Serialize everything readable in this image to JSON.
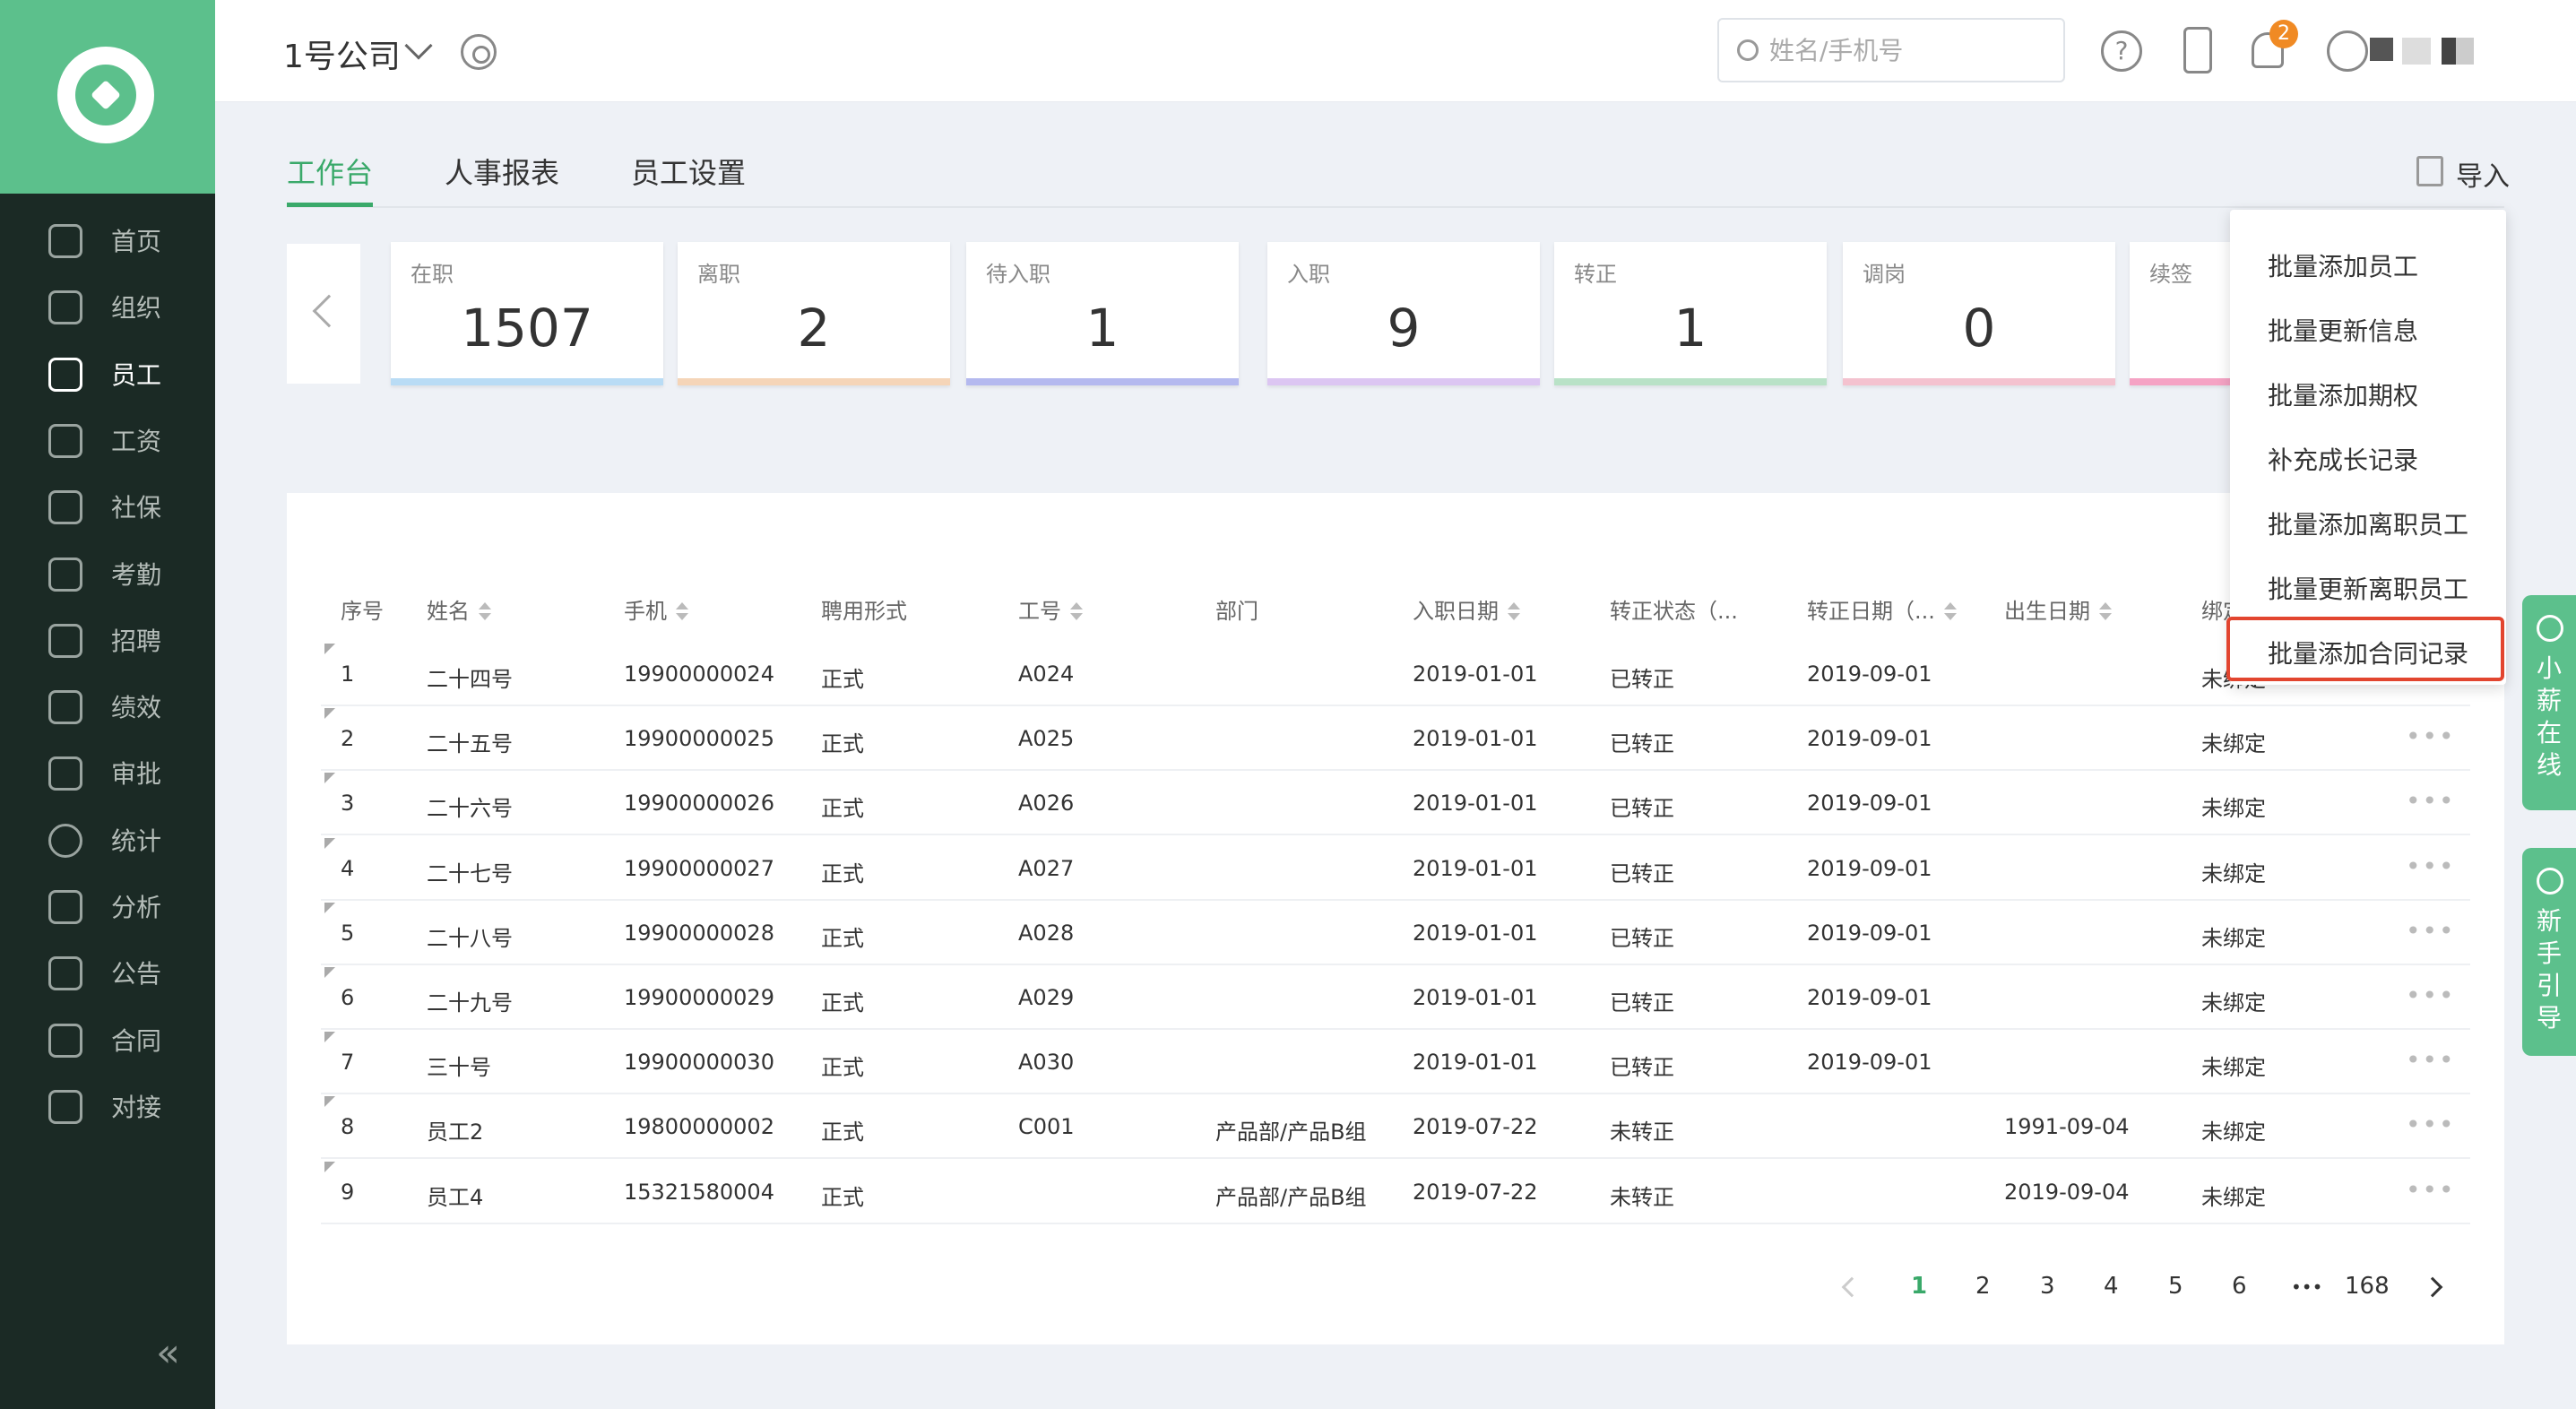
{
  "sidebar": {
    "items": [
      {
        "label": "首页",
        "icon": "home-icon"
      },
      {
        "label": "组织",
        "icon": "org-icon"
      },
      {
        "label": "员工",
        "icon": "employee-icon"
      },
      {
        "label": "工资",
        "icon": "wallet-icon"
      },
      {
        "label": "社保",
        "icon": "shield-icon"
      },
      {
        "label": "考勤",
        "icon": "attendance-icon"
      },
      {
        "label": "招聘",
        "icon": "recruit-icon"
      },
      {
        "label": "绩效",
        "icon": "performance-icon"
      },
      {
        "label": "审批",
        "icon": "stamp-icon"
      },
      {
        "label": "统计",
        "icon": "pie-chart-icon"
      },
      {
        "label": "分析",
        "icon": "analytics-icon"
      },
      {
        "label": "公告",
        "icon": "announcement-icon"
      },
      {
        "label": "合同",
        "icon": "contract-icon"
      },
      {
        "label": "对接",
        "icon": "integration-icon"
      }
    ],
    "active_index": 2
  },
  "header": {
    "company": "1号公司",
    "search_placeholder": "姓名/手机号",
    "help_symbol": "?",
    "notification_count": "2"
  },
  "tabs": [
    {
      "label": "工作台"
    },
    {
      "label": "人事报表"
    },
    {
      "label": "员工设置"
    }
  ],
  "import_label": "导入",
  "stats": [
    {
      "label": "在职",
      "value": "1507",
      "color": "#b9dcf5"
    },
    {
      "label": "离职",
      "value": "2",
      "color": "#f5d5b8"
    },
    {
      "label": "待入职",
      "value": "1",
      "color": "#b4b9ef"
    },
    {
      "label": "入职",
      "value": "9",
      "color": "#dcc6f2"
    },
    {
      "label": "转正",
      "value": "1",
      "color": "#b9e2c7"
    },
    {
      "label": "调岗",
      "value": "0",
      "color": "#f4c2cf"
    },
    {
      "label": "续签",
      "value": "",
      "color": "#f5a3c4"
    }
  ],
  "table": {
    "columns": [
      "序号",
      "姓名",
      "手机",
      "聘用形式",
      "工号",
      "部门",
      "入职日期",
      "转正状态（...",
      "转正日期（...",
      "出生日期",
      "绑定"
    ],
    "rows": [
      {
        "no": "1",
        "name": "二十四号",
        "phone": "19900000024",
        "type": "正式",
        "id": "A024",
        "dept": "",
        "hire": "2019-01-01",
        "status": "已转正",
        "regular": "2019-09-01",
        "birth": "",
        "bind": "未绑定"
      },
      {
        "no": "2",
        "name": "二十五号",
        "phone": "19900000025",
        "type": "正式",
        "id": "A025",
        "dept": "",
        "hire": "2019-01-01",
        "status": "已转正",
        "regular": "2019-09-01",
        "birth": "",
        "bind": "未绑定"
      },
      {
        "no": "3",
        "name": "二十六号",
        "phone": "19900000026",
        "type": "正式",
        "id": "A026",
        "dept": "",
        "hire": "2019-01-01",
        "status": "已转正",
        "regular": "2019-09-01",
        "birth": "",
        "bind": "未绑定"
      },
      {
        "no": "4",
        "name": "二十七号",
        "phone": "19900000027",
        "type": "正式",
        "id": "A027",
        "dept": "",
        "hire": "2019-01-01",
        "status": "已转正",
        "regular": "2019-09-01",
        "birth": "",
        "bind": "未绑定"
      },
      {
        "no": "5",
        "name": "二十八号",
        "phone": "19900000028",
        "type": "正式",
        "id": "A028",
        "dept": "",
        "hire": "2019-01-01",
        "status": "已转正",
        "regular": "2019-09-01",
        "birth": "",
        "bind": "未绑定"
      },
      {
        "no": "6",
        "name": "二十九号",
        "phone": "19900000029",
        "type": "正式",
        "id": "A029",
        "dept": "",
        "hire": "2019-01-01",
        "status": "已转正",
        "regular": "2019-09-01",
        "birth": "",
        "bind": "未绑定"
      },
      {
        "no": "7",
        "name": "三十号",
        "phone": "19900000030",
        "type": "正式",
        "id": "A030",
        "dept": "",
        "hire": "2019-01-01",
        "status": "已转正",
        "regular": "2019-09-01",
        "birth": "",
        "bind": "未绑定"
      },
      {
        "no": "8",
        "name": "员工2",
        "phone": "19800000002",
        "type": "正式",
        "id": "C001",
        "dept": "产品部/产品B组",
        "hire": "2019-07-22",
        "status": "未转正",
        "regular": "",
        "birth": "1991-09-04",
        "bind": "未绑定"
      },
      {
        "no": "9",
        "name": "员工4",
        "phone": "15321580004",
        "type": "正式",
        "id": "",
        "dept": "产品部/产品B组",
        "hire": "2019-07-22",
        "status": "未转正",
        "regular": "",
        "birth": "2019-09-04",
        "bind": "未绑定"
      }
    ],
    "more_symbol": "•••"
  },
  "pagination": {
    "pages": [
      "1",
      "2",
      "3",
      "4",
      "5",
      "6",
      "•••",
      "168"
    ],
    "current": "1"
  },
  "import_menu": {
    "items": [
      "批量添加员工",
      "批量更新信息",
      "批量添加期权",
      "补充成长记录",
      "批量添加离职员工",
      "批量更新离职员工",
      "批量添加合同记录"
    ],
    "highlighted_index": 6,
    "highlight_color": "#e2452f"
  },
  "float_widgets": [
    {
      "label": "小薪在线",
      "icon": "headset-icon"
    },
    {
      "label": "新手引导",
      "icon": "compass-icon"
    }
  ],
  "colors": {
    "brand": "#5cc08c",
    "accent": "#3aa96a",
    "sidebar_bg": "#1b2a25"
  }
}
